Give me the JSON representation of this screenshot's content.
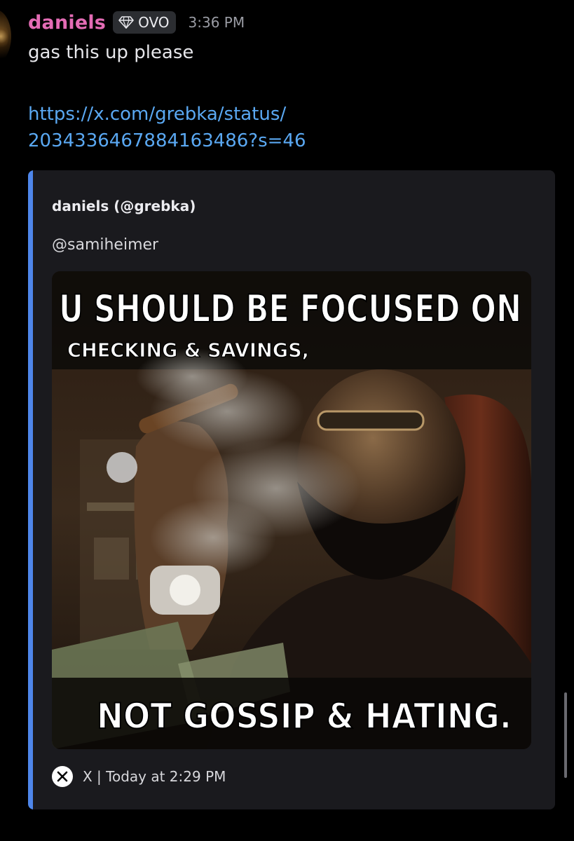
{
  "message": {
    "author": "daniels",
    "badge_icon": "diamond-icon",
    "badge_label": "OVO",
    "timestamp": "3:36 PM",
    "text": "gas this up please",
    "link_line1": "https://x.com/grebka/status/",
    "link_line2": "2034336467884163486?s=46"
  },
  "embed": {
    "accent_color": "#4e86ea",
    "author": "daniels (@grebka)",
    "description": "@samiheimer",
    "image": {
      "caption_top": "U SHOULD BE FOCUSED ON",
      "caption_middle": "CHECKING & SAVINGS,",
      "caption_bottom": "NOT GOSSIP & HATING."
    },
    "footer_icon": "x-logo-icon",
    "footer_text": "X | Today at 2:29 PM"
  },
  "colors": {
    "username": "#e46cb5",
    "link": "#5aa8f2",
    "embed_bg": "#1a1a1e"
  }
}
